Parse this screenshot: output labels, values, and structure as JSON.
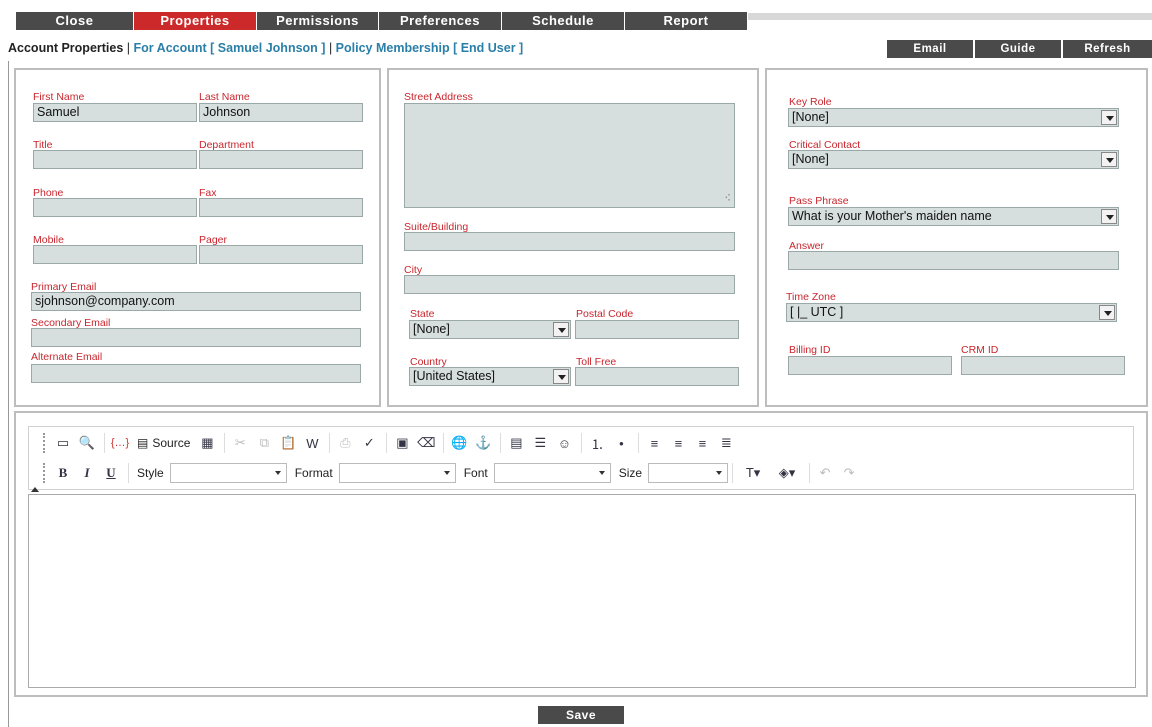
{
  "tabs": [
    {
      "label": "Close"
    },
    {
      "label": "Properties"
    },
    {
      "label": "Permissions"
    },
    {
      "label": "Preferences"
    },
    {
      "label": "Schedule"
    },
    {
      "label": "Report"
    }
  ],
  "header": {
    "title": "Account Properties",
    "separator": "|",
    "account_link": "For Account [ Samuel Johnson ]",
    "policy_link": "Policy Membership [ End User ]",
    "buttons": {
      "email": "Email",
      "guide": "Guide",
      "refresh": "Refresh"
    }
  },
  "contact": {
    "first_name": {
      "label": "First Name",
      "value": "Samuel"
    },
    "last_name": {
      "label": "Last Name",
      "value": "Johnson"
    },
    "title": {
      "label": "Title",
      "value": ""
    },
    "department": {
      "label": "Department",
      "value": ""
    },
    "phone": {
      "label": "Phone",
      "value": ""
    },
    "fax": {
      "label": "Fax",
      "value": ""
    },
    "mobile": {
      "label": "Mobile",
      "value": ""
    },
    "pager": {
      "label": "Pager",
      "value": ""
    },
    "primary_email": {
      "label": "Primary Email",
      "value": "sjohnson@company.com"
    },
    "secondary_email": {
      "label": "Secondary Email",
      "value": ""
    },
    "alternate_email": {
      "label": "Alternate Email",
      "value": ""
    }
  },
  "address": {
    "street": {
      "label": "Street Address",
      "value": ""
    },
    "suite": {
      "label": "Suite/Building",
      "value": ""
    },
    "city": {
      "label": "City",
      "value": ""
    },
    "state": {
      "label": "State",
      "value": "[None]"
    },
    "postal_code": {
      "label": "Postal Code",
      "value": ""
    },
    "country": {
      "label": "Country",
      "value": "[United States]"
    },
    "toll_free": {
      "label": "Toll Free",
      "value": ""
    }
  },
  "settings": {
    "key_role": {
      "label": "Key Role",
      "value": "[None]"
    },
    "critical_contact": {
      "label": "Critical Contact",
      "value": "[None]"
    },
    "pass_phrase": {
      "label": "Pass Phrase",
      "value": "What is your Mother's maiden name"
    },
    "answer": {
      "label": "Answer",
      "value": ""
    },
    "time_zone": {
      "label": "Time Zone",
      "value": "[ |_ UTC ]"
    },
    "billing_id": {
      "label": "Billing ID",
      "value": ""
    },
    "crm_id": {
      "label": "CRM ID",
      "value": ""
    }
  },
  "editor": {
    "source_label": "Source",
    "style_label": "Style",
    "format_label": "Format",
    "font_label": "Font",
    "size_label": "Size",
    "bold": "B",
    "italic": "I",
    "underline": "U"
  },
  "save_label": "Save"
}
